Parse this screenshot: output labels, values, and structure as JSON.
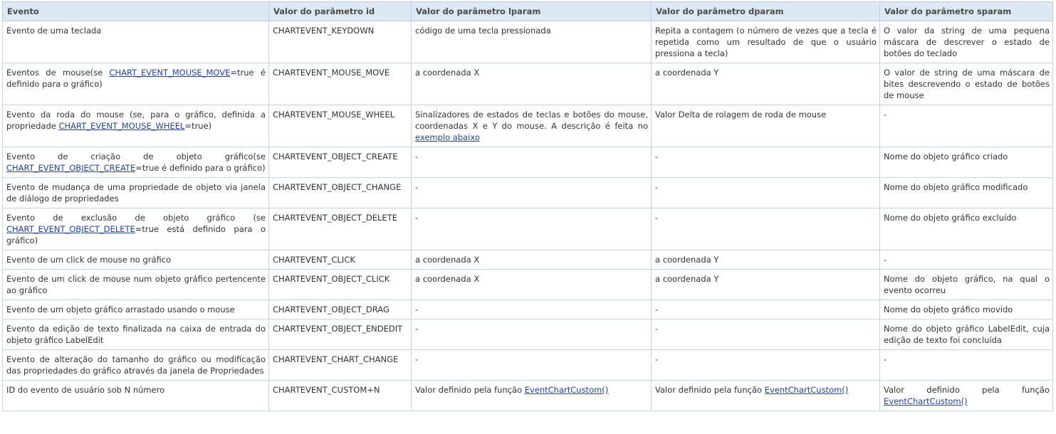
{
  "table": {
    "headers": [
      "Evento",
      "Valor do parâmetro id",
      "Valor do parâmetro lparam",
      "Valor do parâmetro dparam",
      "Valor do parâmetro sparam"
    ],
    "rows": [
      {
        "evento": {
          "pre": "Evento de uma teclada"
        },
        "id": "CHARTEVENT_KEYDOWN",
        "lparam": {
          "pre": "código de uma tecla pressionada"
        },
        "dparam": {
          "pre": "Repita a contagem (o número de vezes que a tecla é repetida como um resultado de que o usuário pressiona a tecla)"
        },
        "sparam": {
          "pre": "O valor da string de uma pequena máscara de descrever o estado de botões do teclado"
        }
      },
      {
        "evento": {
          "pre": "Eventos de mouse(se ",
          "link": "CHART_EVENT_MOUSE_MOVE",
          "post": "=true é definido para o gráfico)"
        },
        "id": "CHARTEVENT_MOUSE_MOVE",
        "lparam": {
          "pre": "a coordenada X"
        },
        "dparam": {
          "pre": "a coordenada Y"
        },
        "sparam": {
          "pre": "O valor de string de uma máscara de bites descrevendo o estado de botões de mouse"
        }
      },
      {
        "evento": {
          "pre": "Evento da roda do mouse (se, para o gráfico, definida a propriedade ",
          "link": "CHART_EVENT_MOUSE_WHEEL",
          "post": "=true)"
        },
        "id": "CHARTEVENT_MOUSE_WHEEL",
        "lparam": {
          "pre": "Sinalizadores de estados de teclas e botões do mouse, coordenadas X e Y do mouse. A descrição é feita no ",
          "link": "exemplo abaixo"
        },
        "dparam": {
          "pre": "Valor Delta de rolagem de roda de mouse"
        },
        "sparam": {
          "pre": "-"
        }
      },
      {
        "evento": {
          "pre": "Evento de criação de objeto gráfico(se ",
          "link": "CHART_EVENT_OBJECT_CREATE",
          "post": "=true é definido para o gráfico)"
        },
        "id": "CHARTEVENT_OBJECT_CREATE",
        "lparam": {
          "pre": "-"
        },
        "dparam": {
          "pre": "-"
        },
        "sparam": {
          "pre": "Nome do objeto gráfico criado"
        }
      },
      {
        "evento": {
          "pre": "Evento de mudança de uma propriedade de objeto via janela de diálogo de propriedades"
        },
        "id": "CHARTEVENT_OBJECT_CHANGE",
        "lparam": {
          "pre": "-"
        },
        "dparam": {
          "pre": "-"
        },
        "sparam": {
          "pre": "Nome do objeto gráfico modificado"
        }
      },
      {
        "evento": {
          "pre": "Evento de exclusão de objeto gráfico (se ",
          "link": "CHART_EVENT_OBJECT_DELETE",
          "post": "=true está definido para o gráfico)"
        },
        "id": "CHARTEVENT_OBJECT_DELETE",
        "lparam": {
          "pre": "-"
        },
        "dparam": {
          "pre": "-"
        },
        "sparam": {
          "pre": "Nome do objeto gráfico excluído"
        }
      },
      {
        "evento": {
          "pre": "Evento de um click de mouse no gráfico"
        },
        "id": "CHARTEVENT_CLICK",
        "lparam": {
          "pre": "a coordenada X"
        },
        "dparam": {
          "pre": "a coordenada Y"
        },
        "sparam": {
          "pre": "-"
        }
      },
      {
        "evento": {
          "pre": "Evento de um click de mouse num objeto gráfico pertencente ao gráfico"
        },
        "id": "CHARTEVENT_OBJECT_CLICK",
        "lparam": {
          "pre": "a coordenada X"
        },
        "dparam": {
          "pre": "a coordenada Y"
        },
        "sparam": {
          "pre": "Nome do objeto gráfico, na qual o evento ocorreu"
        }
      },
      {
        "evento": {
          "pre": "Evento de um objeto gráfico arrastado usando o mouse"
        },
        "id": "CHARTEVENT_OBJECT_DRAG",
        "lparam": {
          "pre": "-"
        },
        "dparam": {
          "pre": "-"
        },
        "sparam": {
          "pre": "Nome do objeto gráfico movido"
        }
      },
      {
        "evento": {
          "pre": "Evento da edição de texto finalizada na caixa de entrada do objeto gráfico LabelEdit"
        },
        "id": "CHARTEVENT_OBJECT_ENDEDIT",
        "lparam": {
          "pre": "-"
        },
        "dparam": {
          "pre": "-"
        },
        "sparam": {
          "pre": "Nome do objeto gráfico LabelEdit, cuja edição de texto foi concluída"
        }
      },
      {
        "evento": {
          "pre": "Evento de alteração do tamanho do gráfico ou modificação das propriedades do gráfico através da janela de Propriedades"
        },
        "id": "CHARTEVENT_CHART_CHANGE",
        "lparam": {
          "pre": "-"
        },
        "dparam": {
          "pre": "-"
        },
        "sparam": {
          "pre": "-"
        }
      },
      {
        "evento": {
          "pre": "ID do evento de usuário sob N número"
        },
        "id": "CHARTEVENT_CUSTOM+N",
        "lparam": {
          "pre": "Valor definido pela função ",
          "link": "EventChartCustom()"
        },
        "dparam": {
          "pre": "Valor definido pela função ",
          "link": "EventChartCustom()"
        },
        "sparam": {
          "pre": "Valor definido pela função ",
          "link": "EventChartCustom()"
        }
      }
    ]
  }
}
